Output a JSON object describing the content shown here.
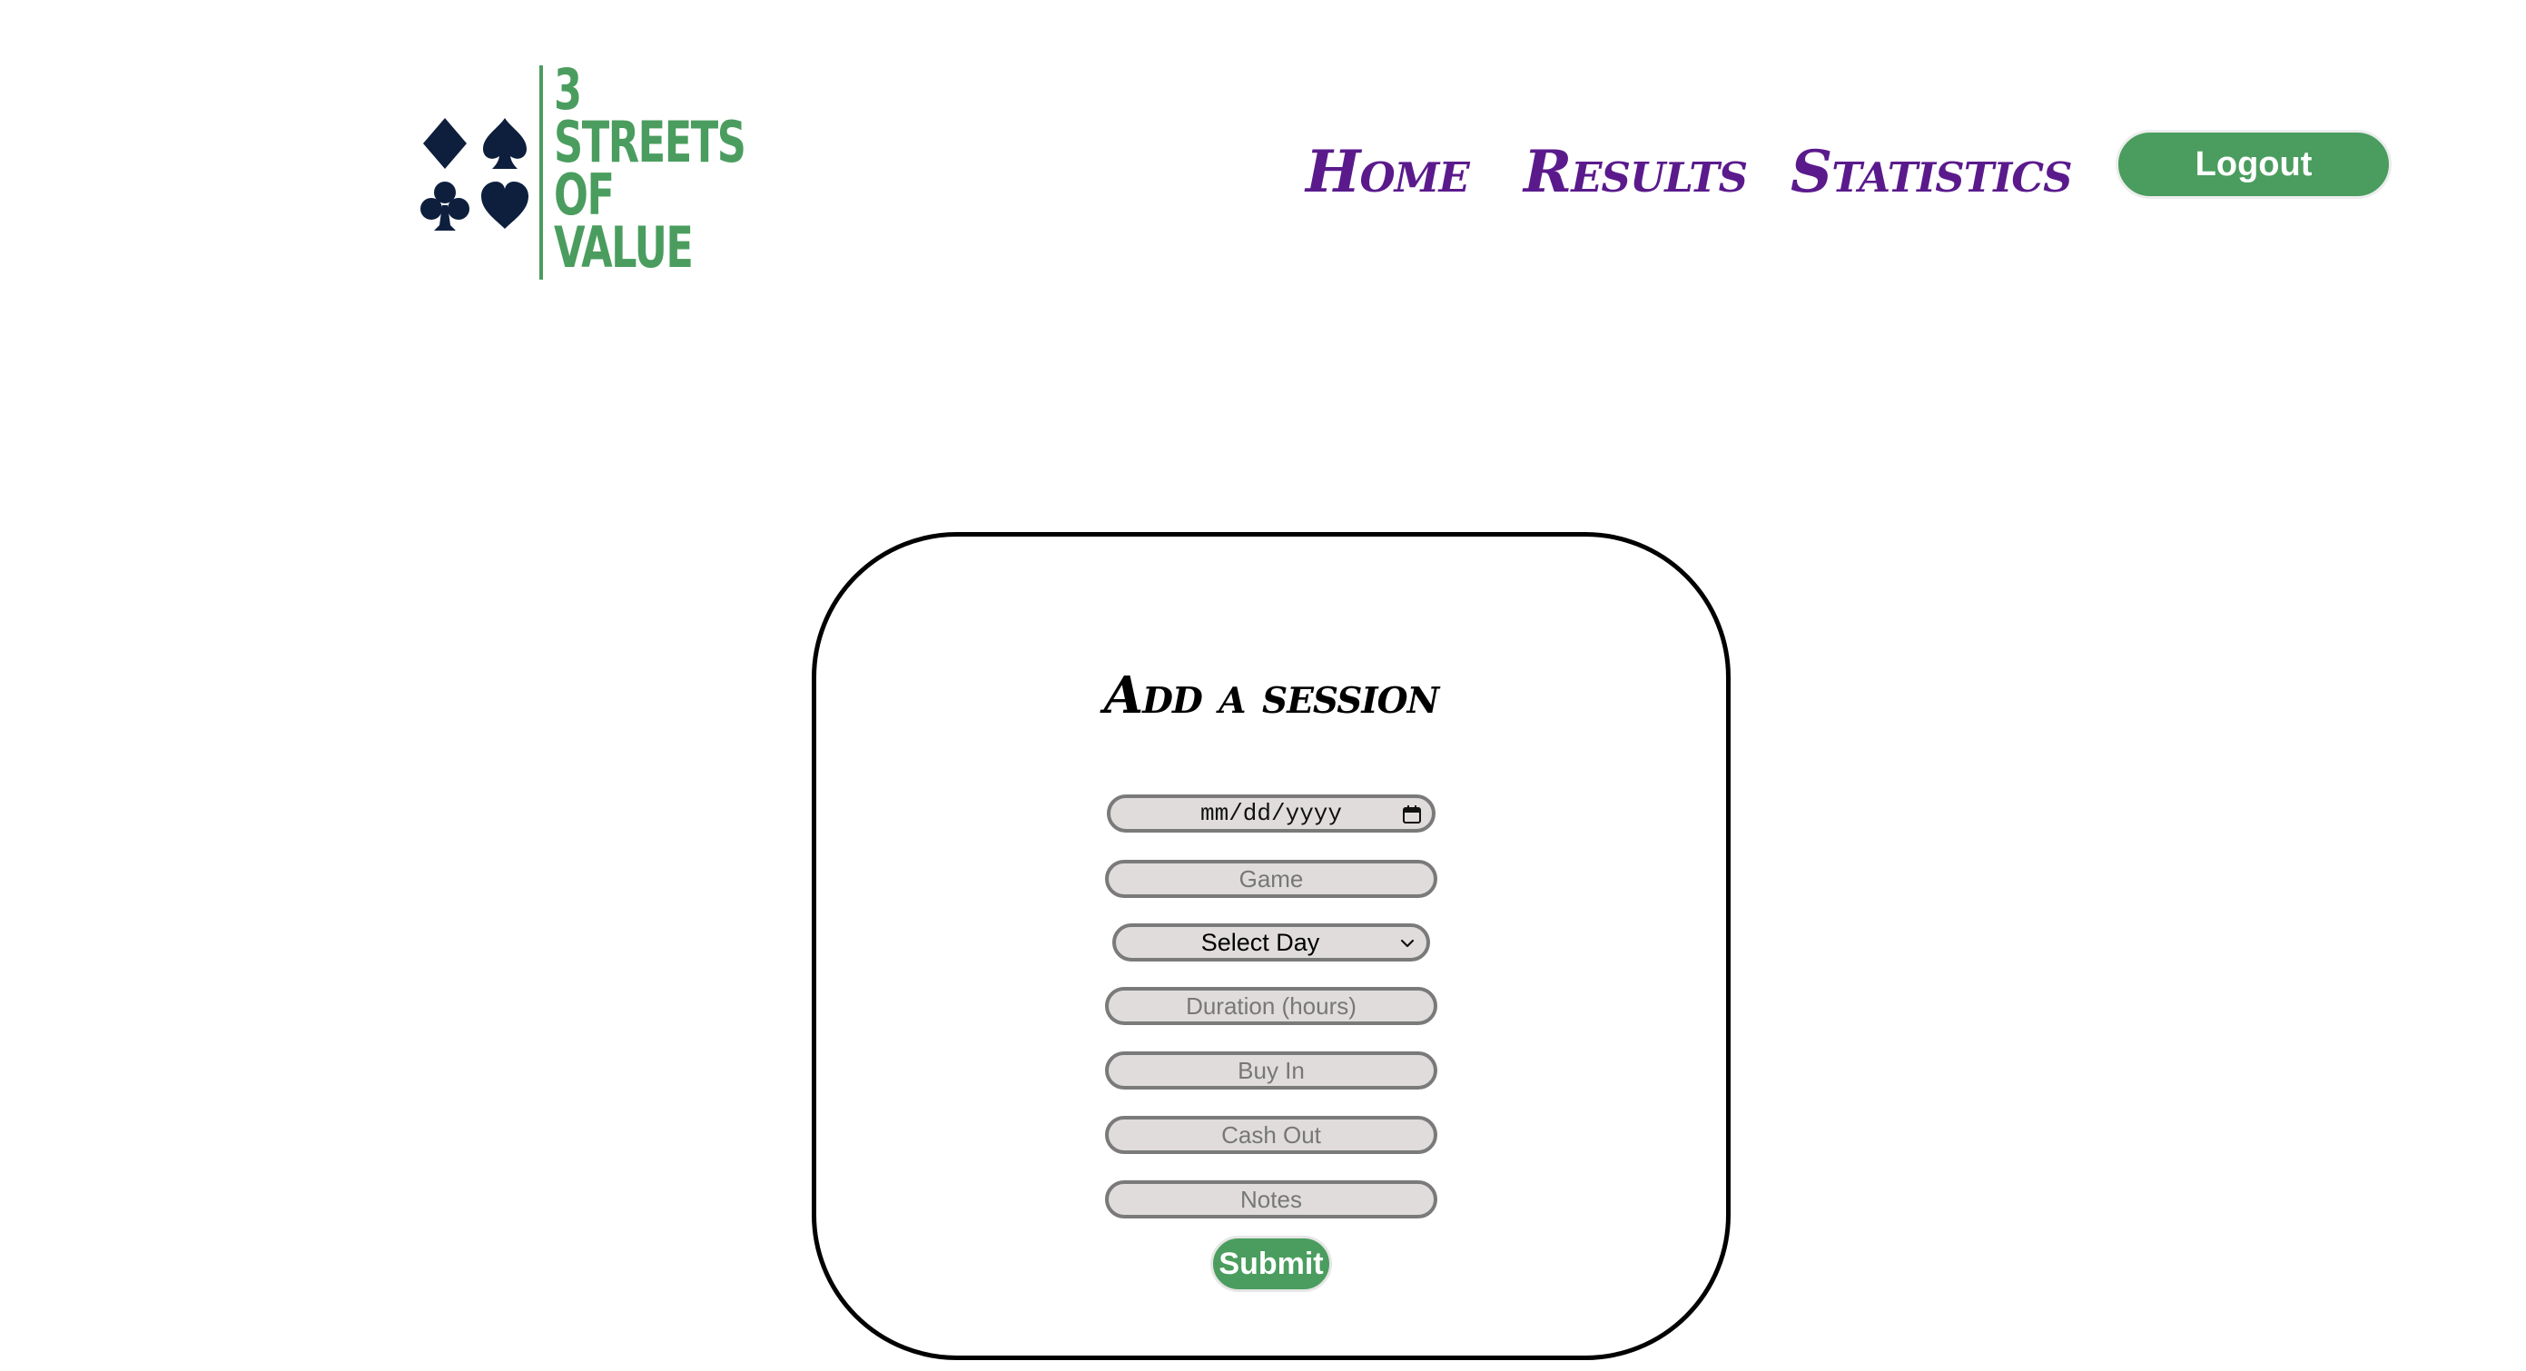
{
  "logo": {
    "lines": [
      "3",
      "STREETS",
      "OF",
      "VALUE"
    ],
    "suit_icons": [
      "diamond-icon",
      "spade-icon",
      "club-icon",
      "heart-icon"
    ],
    "suit_color": "#0e1f3d",
    "brand_green": "#4a9d5e"
  },
  "nav": {
    "home": "Home",
    "results": "Results",
    "statistics": "Statistics",
    "link_color": "#5a1a8c",
    "logout": "Logout"
  },
  "form": {
    "title": "Add a session",
    "date_placeholder": "mm/dd/yyyy",
    "game_placeholder": "Game",
    "day_select": "Select Day",
    "duration_placeholder": "Duration (hours)",
    "buyin_placeholder": "Buy In",
    "cashout_placeholder": "Cash Out",
    "notes_placeholder": "Notes",
    "submit": "Submit",
    "field_bg": "#e0dcdc"
  }
}
